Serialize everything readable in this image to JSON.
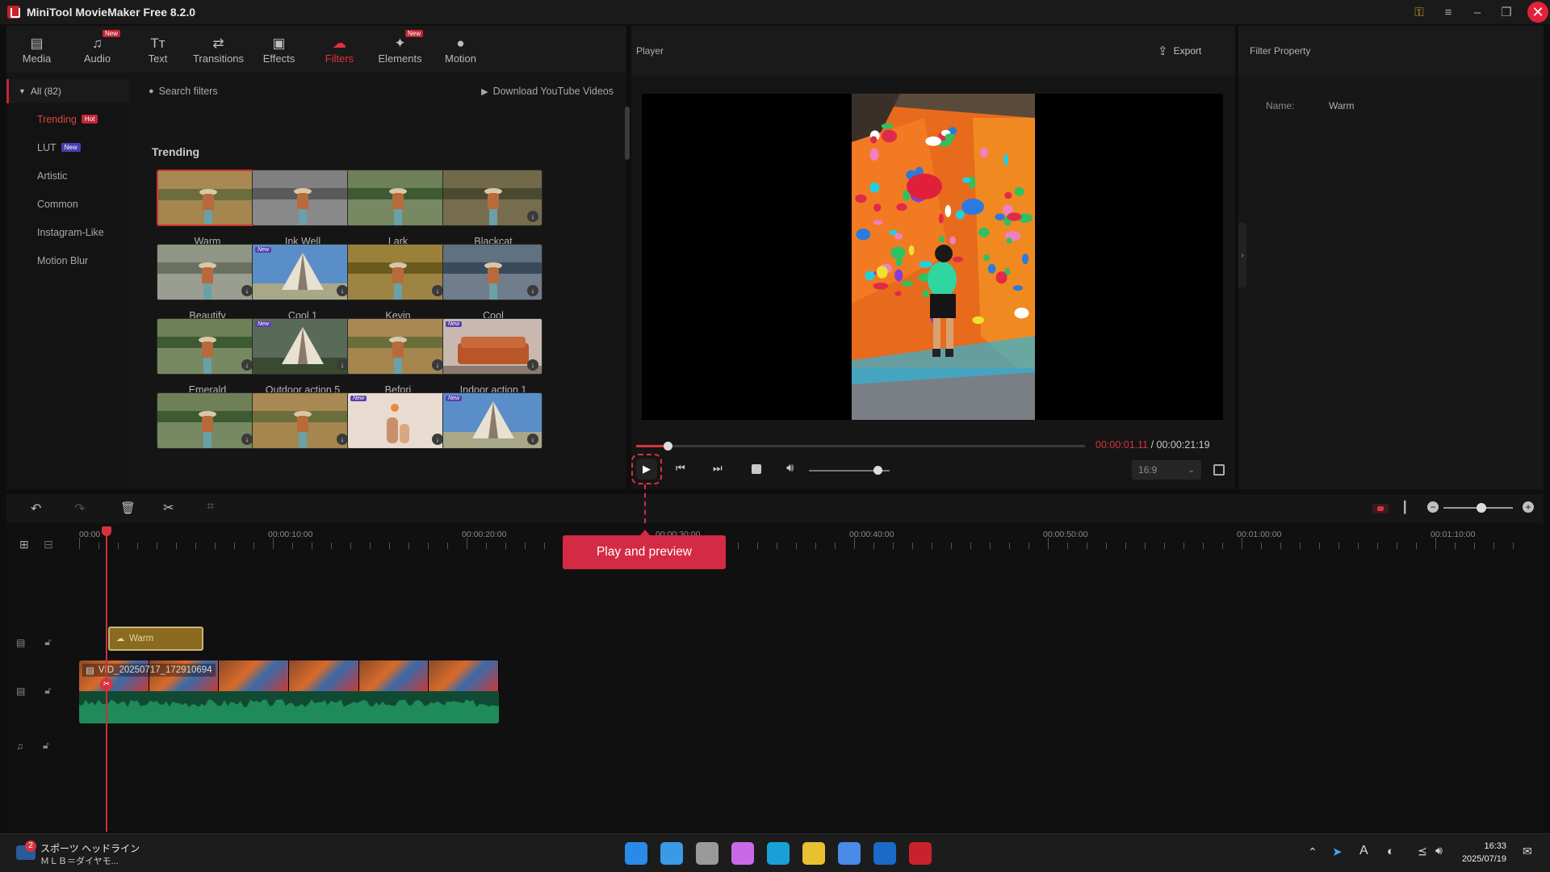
{
  "app": {
    "title": "MiniTool MovieMaker Free 8.2.0"
  },
  "toolbar": {
    "tabs": [
      {
        "label": "Media",
        "icon": "folder-icon",
        "new": false
      },
      {
        "label": "Audio",
        "icon": "music-note-icon",
        "new": true
      },
      {
        "label": "Text",
        "icon": "text-icon",
        "new": false
      },
      {
        "label": "Transitions",
        "icon": "transition-icon",
        "new": false
      },
      {
        "label": "Effects",
        "icon": "effects-icon",
        "new": false
      },
      {
        "label": "Filters",
        "icon": "filters-icon",
        "new": false,
        "active": true
      },
      {
        "label": "Elements",
        "icon": "elements-icon",
        "new": true
      },
      {
        "label": "Motion",
        "icon": "motion-icon",
        "new": false
      }
    ],
    "new_tag": "New"
  },
  "categories": {
    "header": "All (82)",
    "items": [
      {
        "label": "Trending",
        "tag": "Hot",
        "active": true
      },
      {
        "label": "LUT",
        "tag": "New"
      },
      {
        "label": "Artistic"
      },
      {
        "label": "Common"
      },
      {
        "label": "Instagram-Like"
      },
      {
        "label": "Motion Blur"
      }
    ]
  },
  "filters_panel": {
    "search_placeholder": "Search filters",
    "download_youtube": "Download YouTube Videos",
    "section_title": "Trending",
    "items": [
      {
        "name": "Warm",
        "selected": true,
        "scene": "field",
        "tone": "warm"
      },
      {
        "name": "Ink Well",
        "scene": "field",
        "tone": "gray"
      },
      {
        "name": "Lark",
        "scene": "field",
        "tone": "green"
      },
      {
        "name": "Blackcat",
        "scene": "field",
        "tone": "olive",
        "download": true
      },
      {
        "name": "Beautify",
        "scene": "field",
        "tone": "pale",
        "download": true
      },
      {
        "name": "Cool 1",
        "scene": "tent-blue",
        "new": true,
        "download": true
      },
      {
        "name": "Kevin",
        "scene": "field",
        "tone": "gold",
        "download": true
      },
      {
        "name": "Cool",
        "scene": "field",
        "tone": "cool",
        "download": true
      },
      {
        "name": "Emerald",
        "scene": "field",
        "tone": "green",
        "download": true
      },
      {
        "name": "Outdoor action 5",
        "scene": "tent-green",
        "new": true,
        "download": true
      },
      {
        "name": "Befori",
        "scene": "field",
        "tone": "warm",
        "download": true
      },
      {
        "name": "Indoor action 1",
        "scene": "sofa",
        "new": true,
        "download": true
      },
      {
        "name": "",
        "scene": "field",
        "tone": "green",
        "download": true
      },
      {
        "name": "",
        "scene": "field",
        "tone": "warm",
        "download": true
      },
      {
        "name": "",
        "scene": "vase",
        "new": true,
        "download": true
      },
      {
        "name": "",
        "scene": "tent-blue",
        "new": true,
        "download": true
      }
    ]
  },
  "player": {
    "title": "Player",
    "export_label": "Export",
    "current_time": "00:00:01.11",
    "separator": " / ",
    "total_time": "00:00:21:19",
    "aspect_ratio": "16:9",
    "progress": 0.07,
    "volume": 0.85
  },
  "filter_property": {
    "title": "Filter Property",
    "name_label": "Name:",
    "name_value": "Warm"
  },
  "tooltip": {
    "text": "Play and preview"
  },
  "timeline": {
    "ruler_labels": [
      "00:00",
      "00:00:10:00",
      "00:00:20:00",
      "00:00:30:00",
      "00:00:40:00",
      "00:00:50:00",
      "00:01:00:00",
      "00:01:10:00"
    ],
    "filter_clip": "Warm",
    "video_clip": "VID_20250717_172910694",
    "zoom": 0.55
  },
  "taskbar": {
    "news_badge": "2",
    "news_title": "スポーツ ヘッドライン",
    "news_sub": "ＭＬＢ＝ダイヤモ...",
    "time": "16:33",
    "date": "2025/07/19",
    "ime": "A"
  },
  "colors": {
    "accent": "#e0323e",
    "tooltip": "#d42a45",
    "filter_clip": "#8a6a1e",
    "audio_wave": "#1f8a5a"
  }
}
